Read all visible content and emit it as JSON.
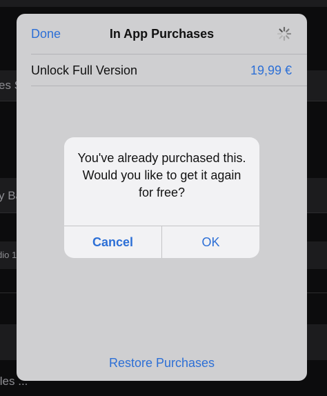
{
  "background": {
    "fragments": [
      "es S",
      "y Ba",
      "dio 1",
      "iles ..."
    ]
  },
  "sheet": {
    "nav": {
      "done_label": "Done",
      "title": "In App Purchases",
      "spinner_icon": "activity-spinner-icon"
    },
    "product": {
      "label": "Unlock Full Version",
      "price": "19,99 €"
    },
    "restore_label": "Restore Purchases"
  },
  "alert": {
    "message": "You've already purchased this. Would you like to get it again for free?",
    "cancel_label": "Cancel",
    "ok_label": "OK"
  },
  "colors": {
    "accent": "#2c6fd6",
    "sheet_bg": "#cfcfd1",
    "alert_bg": "#f2f2f4",
    "app_bg": "#0c0c0d"
  }
}
